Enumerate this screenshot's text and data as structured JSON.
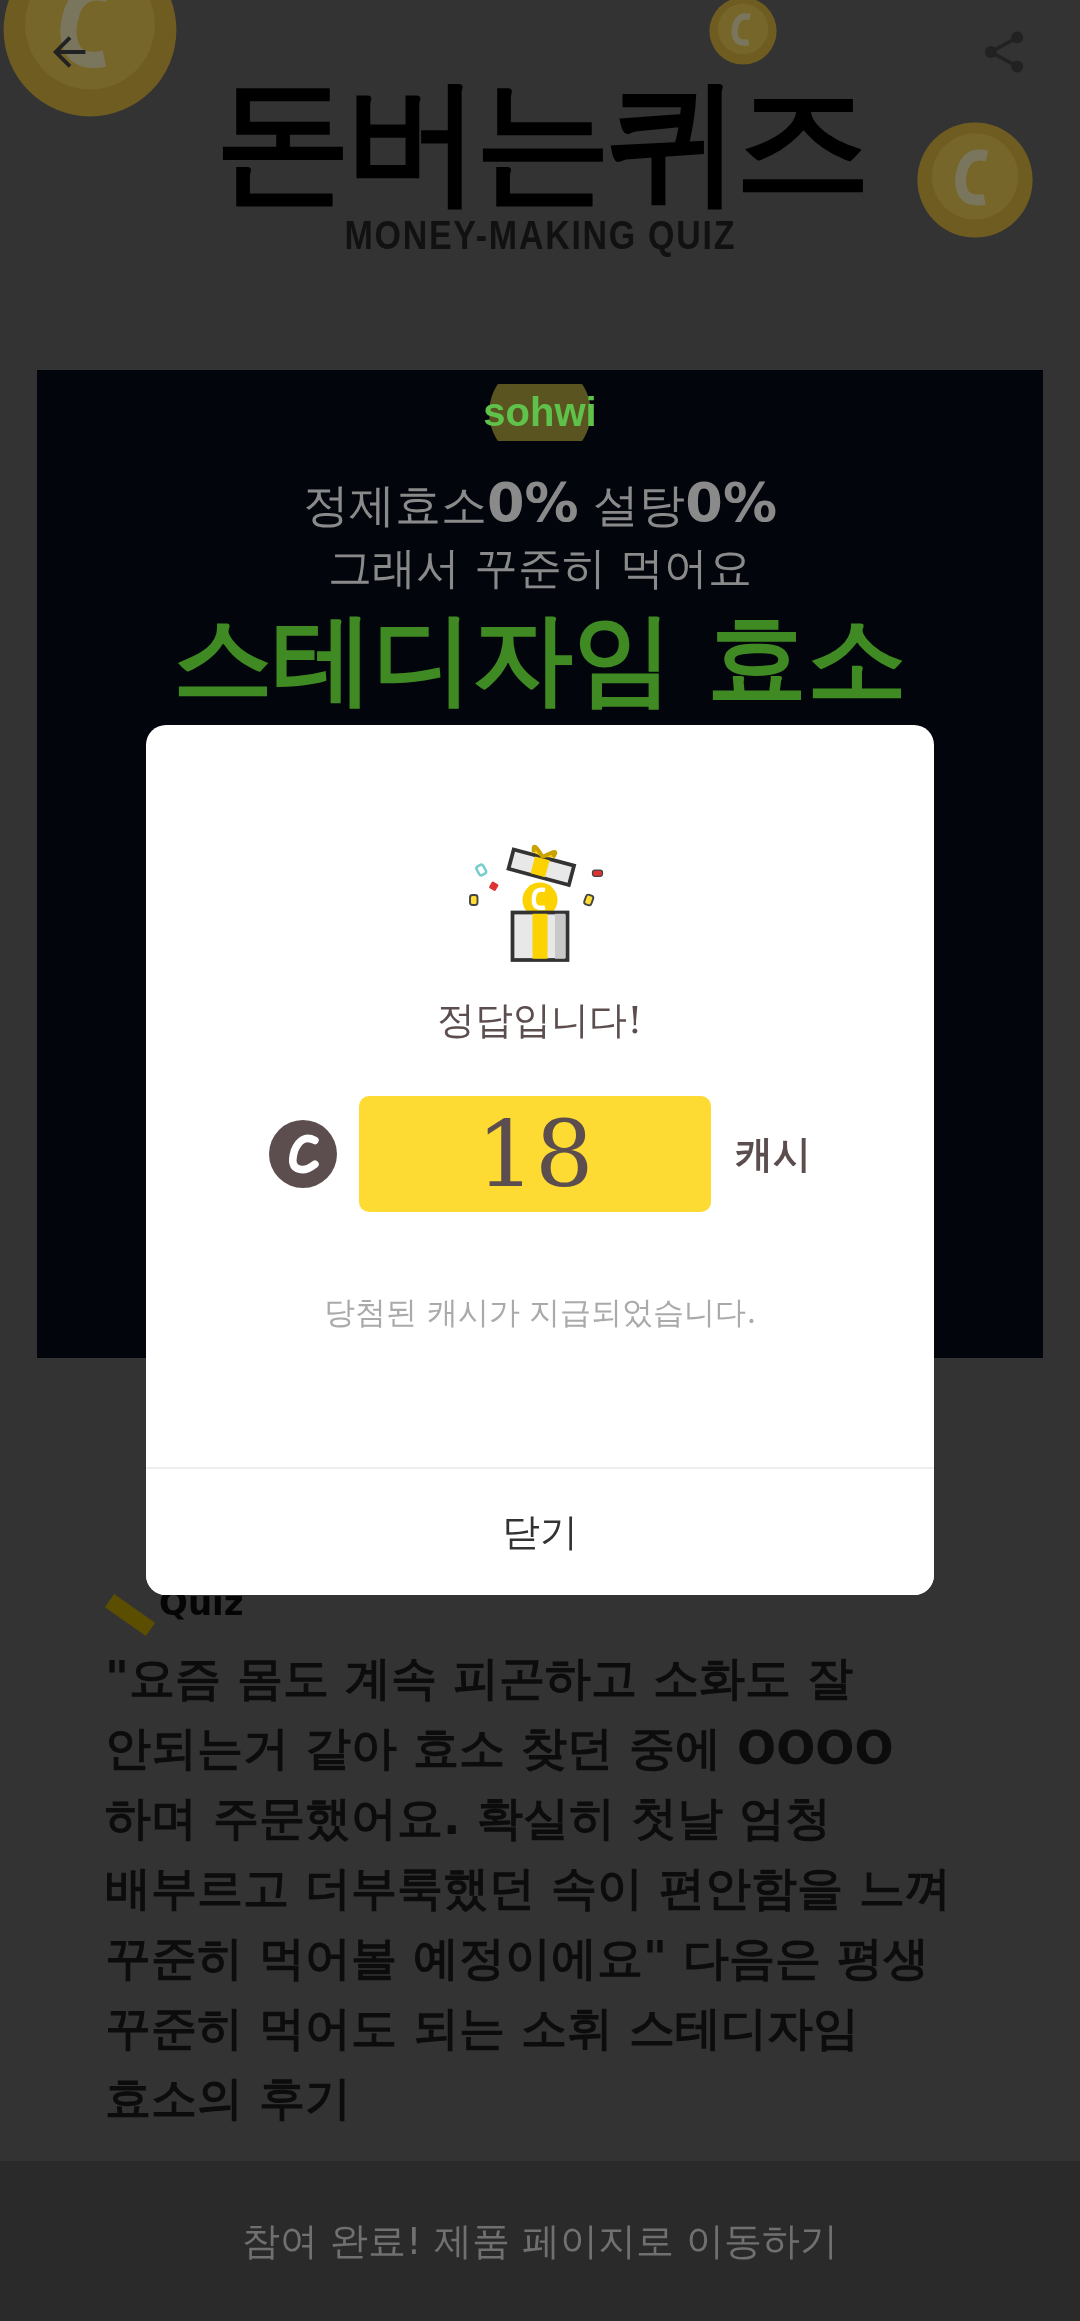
{
  "header": {
    "logo_title": "돈버는퀴즈",
    "logo_subtitle": "MONEY-MAKING QUIZ"
  },
  "banner": {
    "brand": "sohwi",
    "headline": "정제효소**0%** 설탕**0%**",
    "subline": "그래서 꾸준히 먹어요",
    "product": "스테디자임 효소"
  },
  "quiz": {
    "label": "Quiz",
    "question": "\"요즘 몸도 계속 피곤하고 소화도 잘 안되는거 같아 효소 찾던 중에 OOOO 하며 주문했어요. 확실히 첫날 엄청 배부르고 더부룩했던 속이 편안함을 느껴 꾸준히 먹어볼 예정이에요\" 다음은 평생 꾸준히 먹어도 되는 소휘 스테디자임 효소의 후기"
  },
  "bottom_button": {
    "label": "참여 완료! 제품 페이지로 이동하기"
  },
  "dialog": {
    "title": "정답입니다!",
    "amount": "18",
    "unit": "캐시",
    "message": "당첨된 캐시가 지급되었습니다.",
    "close": "닫기"
  }
}
